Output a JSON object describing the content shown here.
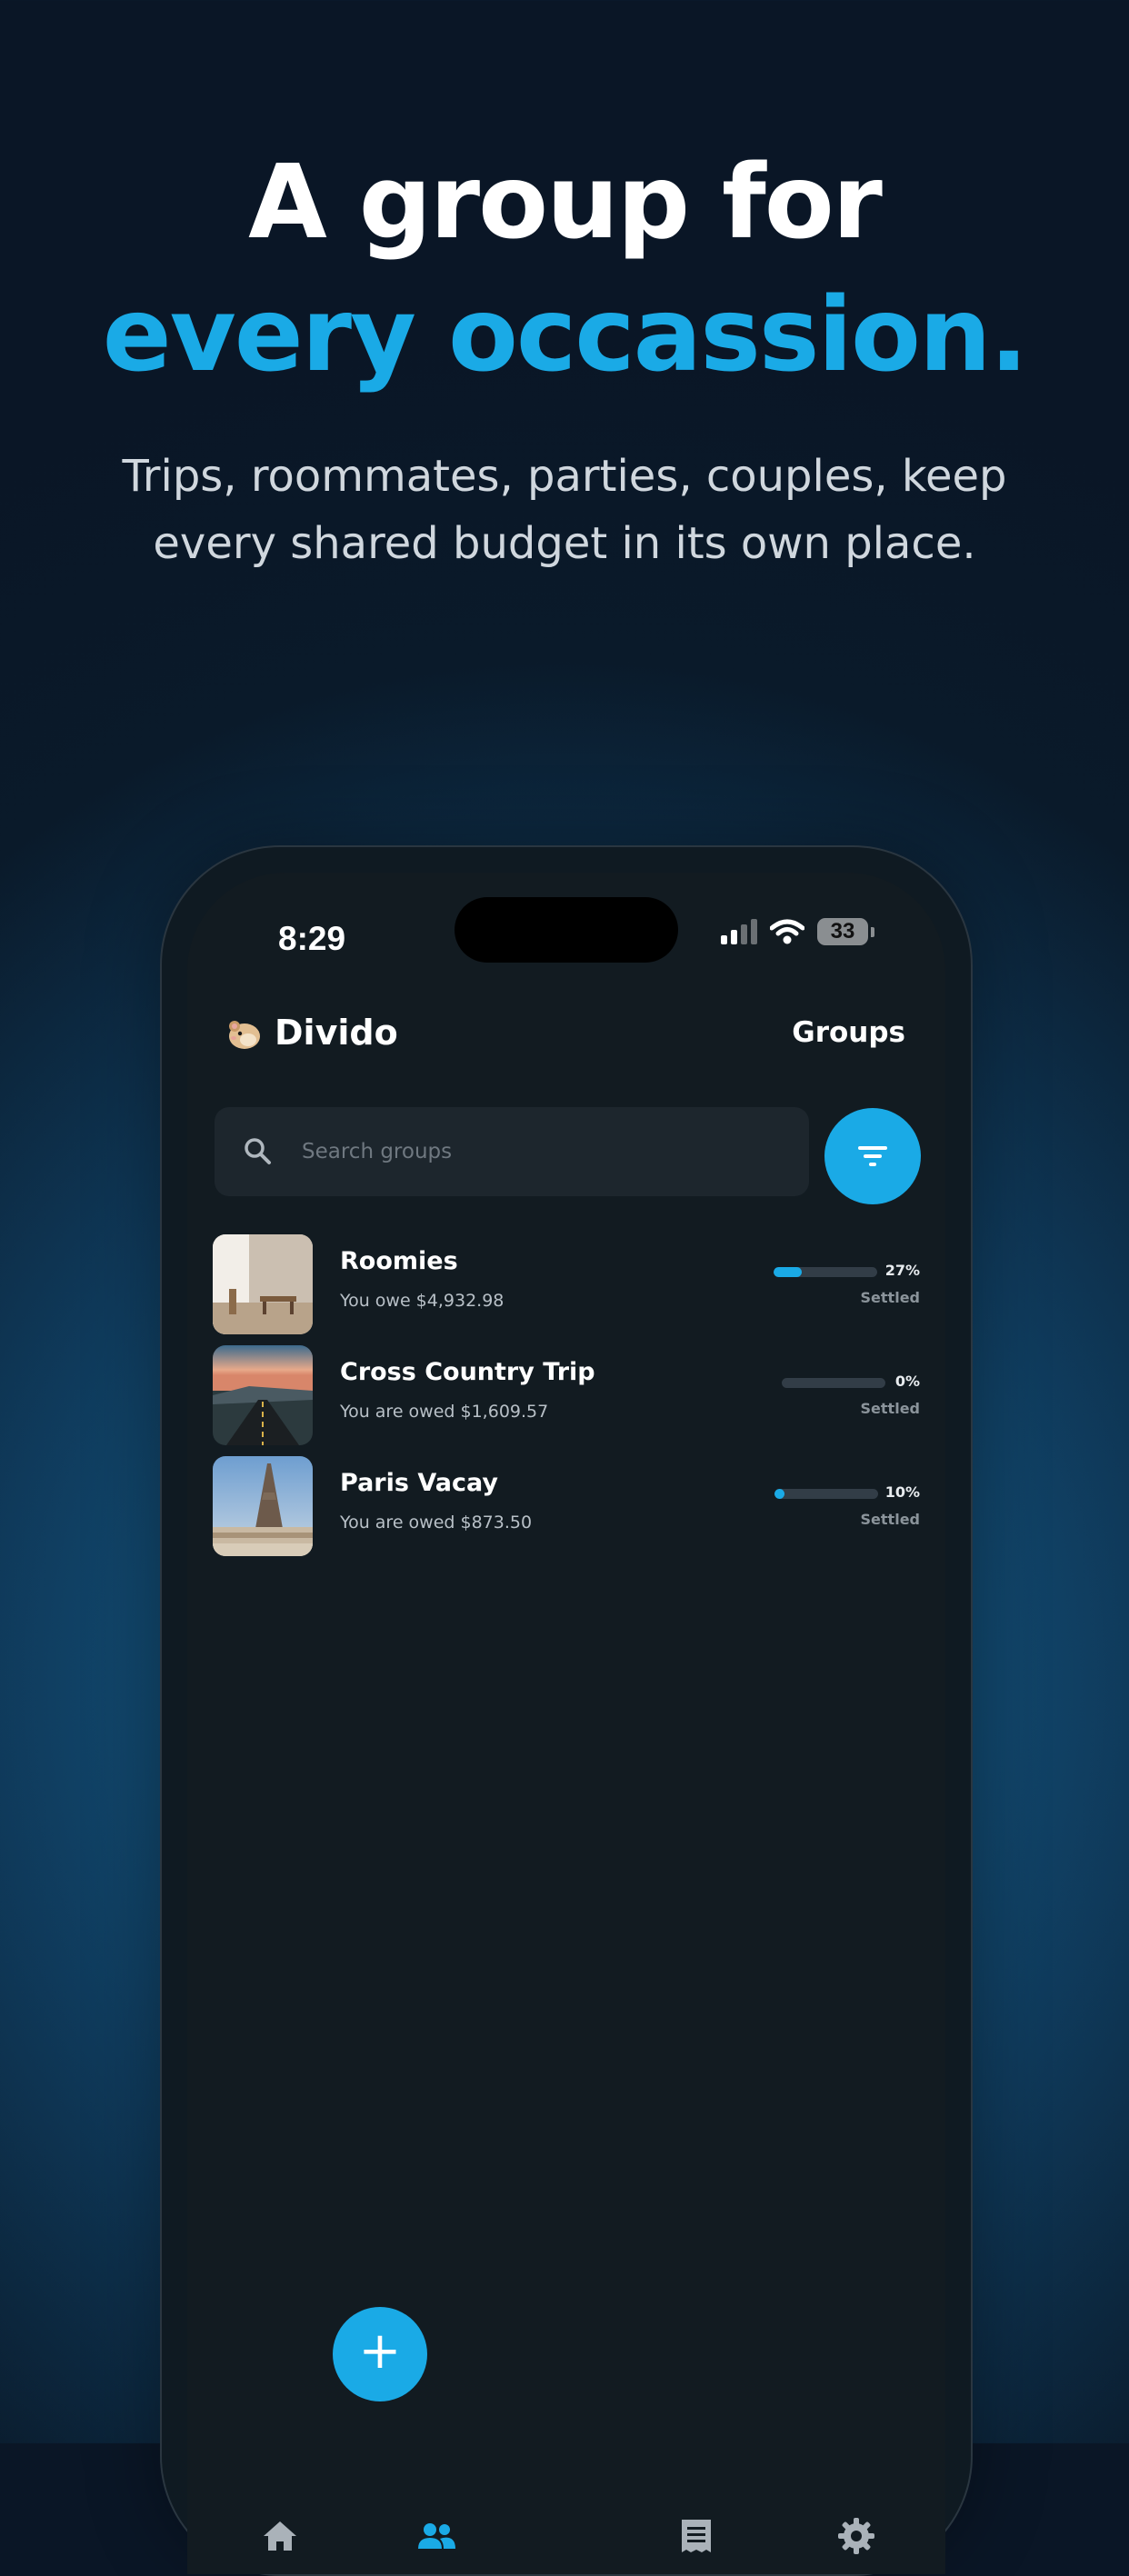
{
  "colors": {
    "accent": "#1aaae6",
    "background": "#0a1626",
    "screen": "#121b21"
  },
  "hero": {
    "line1": "A group for",
    "line2": "every occassion.",
    "subtitle_line1": "Trips, roommates, parties, couples, keep",
    "subtitle_line2": "every shared budget in its own place."
  },
  "status_bar": {
    "time": "8:29",
    "battery": "33"
  },
  "app": {
    "logo_icon": "hamster-emoji",
    "name": "Divido",
    "page_title": "Groups"
  },
  "search": {
    "placeholder": "Search groups",
    "icon": "search-icon"
  },
  "filter_button": {
    "icon": "filter-icon"
  },
  "groups": [
    {
      "name": "Roomies",
      "balance": "You owe $4,932.98",
      "percent_label": "27%",
      "progress": 0.27,
      "status": "Settled",
      "image": "living-room-photo"
    },
    {
      "name": "Cross Country Trip",
      "balance": "You are owed $1,609.57",
      "percent_label": "0%",
      "progress": 0.0,
      "status": "Settled",
      "image": "road-sunset-photo"
    },
    {
      "name": "Paris Vacay",
      "balance": "You are owed $873.50",
      "percent_label": "10%",
      "progress": 0.1,
      "status": "Settled",
      "image": "eiffel-tower-photo"
    }
  ],
  "tabs": [
    {
      "icon": "home-icon",
      "active": false
    },
    {
      "icon": "groups-icon",
      "active": true
    },
    {
      "icon": "add-icon",
      "active": false
    },
    {
      "icon": "receipt-icon",
      "active": false
    },
    {
      "icon": "settings-icon",
      "active": false
    }
  ],
  "fab": {
    "label": "+"
  }
}
